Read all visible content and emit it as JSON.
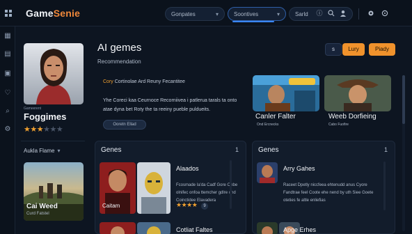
{
  "app": {
    "logo_main": "Game",
    "logo_accent": "Senie"
  },
  "topbar": {
    "tab1": "Gonpates",
    "tab2": "Soontives",
    "search": "Sarld"
  },
  "featured": {
    "subtitle": "Gameerent",
    "title": "Foggimes",
    "rating": 3,
    "rating_max": 6,
    "dropdown": "Aukla Flame"
  },
  "left_card": {
    "title": "Cai Weed",
    "subtitle": "Curd Fatstel"
  },
  "hero": {
    "title": "AI gemes",
    "subtitle": "Recommendation",
    "small_btn": "s",
    "btn1": "Lury",
    "btn2": "Piady",
    "tag_hl": "Cory",
    "tag_rest": " Cortinolae Ard Reuny Fecantitee",
    "desc": "Yhe Coreci kaa Ceurnoce Recorniivea i patlerua tarals ta onto atae dyna bet Roty the ta reeiny pueble puldueits.",
    "cta": "Ooretn Ellad"
  },
  "hero_cards": [
    {
      "title": "Canler Falter",
      "subtitle": "Ond Ercnecks"
    },
    {
      "title": "Weeb Dorfieing",
      "subtitle": "Cabo Fuofire"
    }
  ],
  "panel_left": {
    "title": "Genes",
    "count": "1",
    "item_title": "Alaados",
    "item_text": "Fcosmade Ia'da Cadf Gore Ohbe olnifec onfoa ttemcher gdlre ond Coinctidee Elavadera",
    "item_stars": "★★★★",
    "item_badge": "9",
    "thumb_label": "Caitam",
    "row2_title": "Cotliat Faltes"
  },
  "panel_right": {
    "title": "Genes",
    "count": "1",
    "item_title": "Arry Gahes",
    "item_text": "Raceet Dpetly niccfeea ehtenudd anus Cyore Fandtrae feel Coote ehe nend by uth Siee Goete oteties fe altle enliefias",
    "row2_title": "Apge Erhes"
  },
  "icons": {
    "menu": "menu-icon",
    "info": "info-icon",
    "search": "search-icon",
    "user": "user-icon",
    "settings": "gear-icon",
    "share": "share-icon"
  },
  "colors": {
    "accent": "#f0922c",
    "background": "#0d1521",
    "panel": "#121c2b",
    "highlight": "#3a86ff"
  }
}
